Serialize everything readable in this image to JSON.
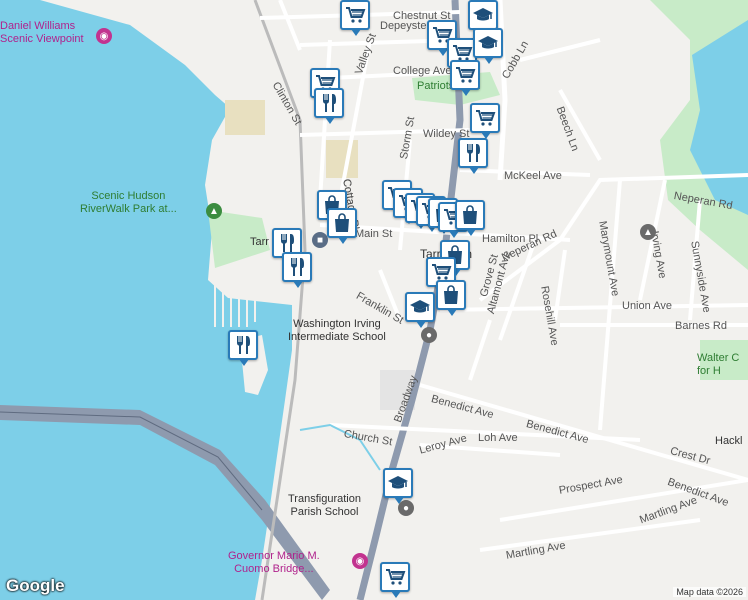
{
  "map": {
    "street_labels": [
      {
        "text": "Chestnut St",
        "name": "street-chestnut"
      },
      {
        "text": "Depeyster St",
        "name": "street-depeyster"
      },
      {
        "text": "College Ave",
        "name": "street-college"
      },
      {
        "text": "Cobb Ln",
        "name": "street-cobb"
      },
      {
        "text": "Valley St",
        "name": "street-valley"
      },
      {
        "text": "Clinton St",
        "name": "street-clinton"
      },
      {
        "text": "Wildey St",
        "name": "street-wildey"
      },
      {
        "text": "Beech Ln",
        "name": "street-beech"
      },
      {
        "text": "McKeel Ave",
        "name": "street-mckeel"
      },
      {
        "text": "Cottage Pl",
        "name": "street-cottage"
      },
      {
        "text": "Storm St",
        "name": "street-storm"
      },
      {
        "text": "Main St",
        "name": "street-main"
      },
      {
        "text": "Hamilton Pl",
        "name": "street-hamilton"
      },
      {
        "text": "Neperan Rd",
        "name": "street-neperan-2"
      },
      {
        "text": "Neperan Rd",
        "name": "street-neperan-1"
      },
      {
        "text": "Marymount Ave",
        "name": "street-marymount"
      },
      {
        "text": "Irving Ave",
        "name": "street-irving"
      },
      {
        "text": "Sunnyside Ave",
        "name": "street-sunnyside"
      },
      {
        "text": "Franklin St",
        "name": "street-franklin"
      },
      {
        "text": "Altamont Ave",
        "name": "street-altamont"
      },
      {
        "text": "Grove St",
        "name": "street-grove"
      },
      {
        "text": "Rosehill Ave",
        "name": "street-rosehill"
      },
      {
        "text": "Union Ave",
        "name": "street-union"
      },
      {
        "text": "Barnes Rd",
        "name": "street-barnes"
      },
      {
        "text": "Benedict Ave",
        "name": "street-benedict-1"
      },
      {
        "text": "Benedict Ave",
        "name": "street-benedict-2"
      },
      {
        "text": "Benedict Ave",
        "name": "street-benedict-3"
      },
      {
        "text": "Broadway",
        "name": "street-broadway"
      },
      {
        "text": "Church St",
        "name": "street-church"
      },
      {
        "text": "Leroy Ave",
        "name": "street-leroy"
      },
      {
        "text": "Loh Ave",
        "name": "street-loh"
      },
      {
        "text": "Crest Dr",
        "name": "street-crest"
      },
      {
        "text": "Prospect Ave",
        "name": "street-prospect"
      },
      {
        "text": "Martling Ave",
        "name": "street-martling-1"
      },
      {
        "text": "Martling Ave",
        "name": "street-martling-2"
      },
      {
        "text": "Cottage Pl",
        "name": "street-cottage-2"
      },
      {
        "text": "Tarrytown",
        "name": "place-tarrytown"
      }
    ],
    "poi_labels": {
      "viewpoint": [
        "Daniel Williams",
        "Scenic Viewpoint"
      ],
      "riverwalk": [
        "Scenic Hudson",
        "RiverWalk Park at..."
      ],
      "washington_irving": [
        "Washington Irving",
        "Intermediate School"
      ],
      "transfiguration": [
        "Transfiguration",
        "Parish School"
      ],
      "cuomo_bridge": [
        "Governor Mario M.",
        "Cuomo Bridge..."
      ],
      "walter": [
        "Walter C",
        "for H"
      ],
      "hackley": "Hackl",
      "patriots_park": "Patriots Park",
      "tarrytown_station": "Tarr"
    },
    "pin_icons": [
      {
        "icon": "shopping-cart-icon"
      },
      {
        "icon": "school-icon"
      },
      {
        "icon": "shopping-cart-icon"
      },
      {
        "icon": "shopping-cart-icon"
      },
      {
        "icon": "school-icon"
      },
      {
        "icon": "shopping-cart-icon"
      },
      {
        "icon": "shopping-cart-icon"
      },
      {
        "icon": "restaurant-icon"
      },
      {
        "icon": "shopping-cart-icon"
      },
      {
        "icon": "restaurant-icon"
      },
      {
        "icon": "shopping-bag-icon"
      },
      {
        "icon": "shopping-bag-icon"
      },
      {
        "icon": "restaurant-icon"
      },
      {
        "icon": "restaurant-icon"
      },
      {
        "icon": "shopping-cart-icon"
      },
      {
        "icon": "shopping-cart-icon"
      },
      {
        "icon": "shopping-cart-icon"
      },
      {
        "icon": "shopping-cart-icon"
      },
      {
        "icon": "shopping-bag-icon"
      },
      {
        "icon": "shopping-cart-icon"
      },
      {
        "icon": "shopping-bag-icon"
      },
      {
        "icon": "shopping-bag-icon"
      },
      {
        "icon": "shopping-cart-icon"
      },
      {
        "icon": "shopping-bag-icon"
      },
      {
        "icon": "school-icon"
      },
      {
        "icon": "restaurant-icon"
      },
      {
        "icon": "school-icon"
      },
      {
        "icon": "shopping-cart-icon"
      }
    ],
    "colors": {
      "water": "#7dcfe8",
      "land": "#f2f1ee",
      "park": "#c8ebc8",
      "road": "#ffffff",
      "highway": "#8e9aae",
      "pin_border": "#2a7ab8",
      "pin_icon": "#1e4f7a"
    }
  },
  "footer": {
    "logo": "Google",
    "attribution": "Map data ©2026"
  }
}
